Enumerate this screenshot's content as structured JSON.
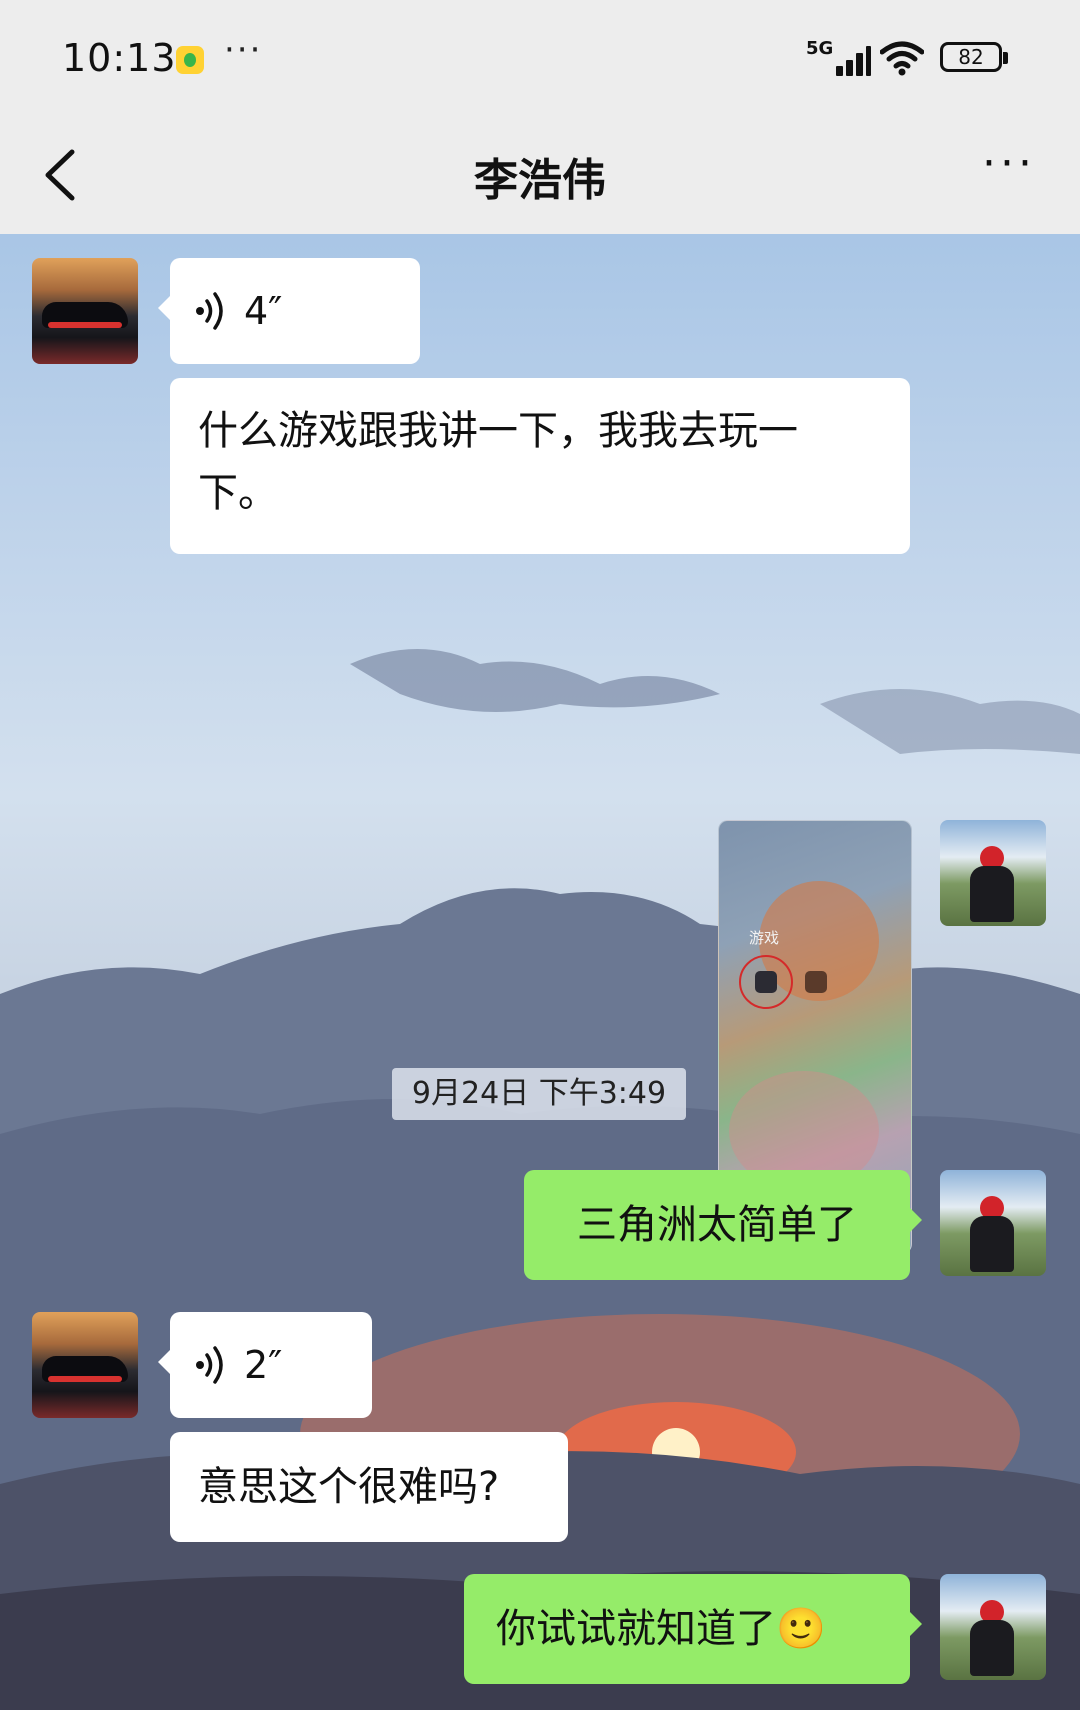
{
  "status_bar": {
    "time": "10:13",
    "app_icon": "qq-music-icon",
    "overflow": "···",
    "network": "5G",
    "battery": "82"
  },
  "nav": {
    "title": "李浩伟",
    "back_icon": "chevron-left-icon",
    "more_icon": "more-horizontal-icon",
    "more": "···"
  },
  "messages": [
    {
      "side": "incoming",
      "type": "voice",
      "duration": "4″"
    },
    {
      "side": "incoming",
      "type": "text",
      "text_line1": "什么游戏跟我讲一下，我我去玩一",
      "text_line2": "下。"
    },
    {
      "side": "outgoing",
      "type": "image",
      "image_label": "游戏"
    },
    {
      "type": "timestamp",
      "text": "9月24日 下午3:49"
    },
    {
      "side": "outgoing",
      "type": "text",
      "text": "三角洲太简单了"
    },
    {
      "side": "incoming",
      "type": "voice",
      "duration": "2″"
    },
    {
      "side": "incoming",
      "type": "text",
      "text": "意思这个很难吗?"
    },
    {
      "side": "outgoing",
      "type": "text",
      "text": "你试试就知道了",
      "emoji": "🙂"
    }
  ],
  "colors": {
    "incoming_bubble": "#ffffff",
    "outgoing_bubble": "#95ec69",
    "bar_background": "#ededed"
  }
}
